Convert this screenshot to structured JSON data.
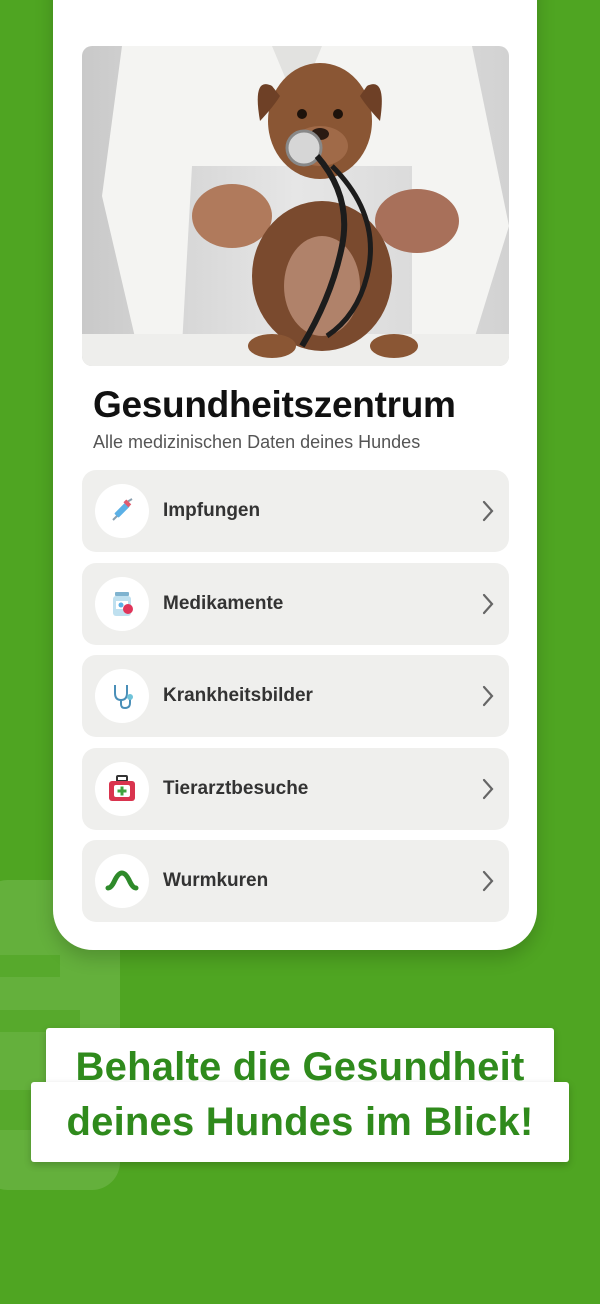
{
  "header": {
    "title": "Gesundheitszentrum",
    "subtitle": "Alle medizinischen Daten deines Hundes"
  },
  "menu": {
    "items": [
      {
        "label": "Impfungen",
        "icon": "syringe-icon"
      },
      {
        "label": "Medikamente",
        "icon": "medicine-bottle-icon"
      },
      {
        "label": "Krankheitsbilder",
        "icon": "stethoscope-icon"
      },
      {
        "label": "Tierarztbesuche",
        "icon": "first-aid-kit-icon"
      },
      {
        "label": "Wurmkuren",
        "icon": "worm-icon"
      }
    ]
  },
  "banner": {
    "line1": "Behalte die Gesundheit",
    "line2": "deines Hundes im Blick!"
  },
  "colors": {
    "background": "#4fa522",
    "accent_green": "#2f8a1c",
    "item_background": "#efefed"
  }
}
